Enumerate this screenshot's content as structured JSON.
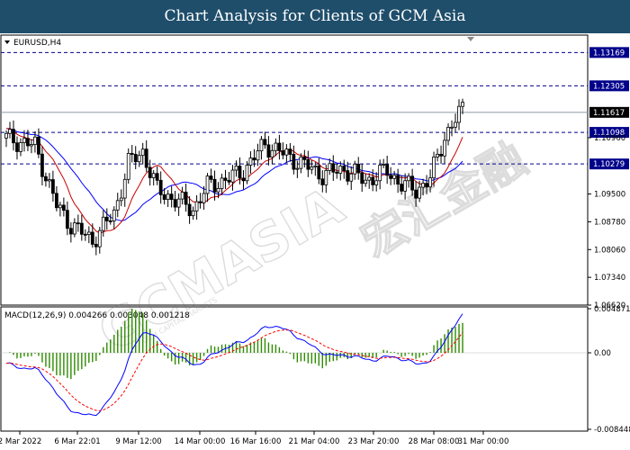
{
  "page": {
    "title": "Chart Analysis for Clients of GCM Asia"
  },
  "chart_data": {
    "type": "candlestick",
    "symbol_label": "EURUSD,H4",
    "price_axis_ticks": [
      "1.10960",
      "1.09500",
      "1.08780",
      "1.08060",
      "1.07340",
      "1.06620"
    ],
    "price_tick_values": [
      1.1096,
      1.095,
      1.0878,
      1.0806,
      1.0734,
      1.0662
    ],
    "horizontal_levels": [
      {
        "label": "1.13169",
        "value": 1.13169,
        "style": "dashed",
        "color": "#00008b"
      },
      {
        "label": "1.12305",
        "value": 1.12305,
        "style": "dashed",
        "color": "#00008b"
      },
      {
        "label": "1.11098",
        "value": 1.11098,
        "style": "dashed",
        "color": "#00008b"
      },
      {
        "label": "1.10279",
        "value": 1.10279,
        "style": "dashed",
        "color": "#00008b"
      }
    ],
    "current_price": {
      "label": "1.11617",
      "value": 1.11617,
      "color": "#000000"
    },
    "price_range": [
      1.0662,
      1.1362
    ],
    "moving_averages": [
      {
        "color": "#0000ff",
        "style": "solid"
      },
      {
        "color": "#cc0000",
        "style": "solid"
      }
    ],
    "candle_colors": {
      "bull": "#ffffff",
      "bear": "#000000",
      "outline": "#000000"
    },
    "time_axis_labels": [
      "2 Mar 2022",
      "6 Mar 22:01",
      "9 Mar 12:00",
      "14 Mar 00:00",
      "16 Mar 16:00",
      "21 Mar 04:00",
      "23 Mar 20:00",
      "28 Mar 08:00",
      "31 Mar 00:00"
    ],
    "macd": {
      "label": "MACD(12,26,9) 0.004266 0.003048 0.001218",
      "axis_ticks": [
        "0.004871",
        "0.00",
        "-0.008448"
      ],
      "axis_values": [
        0.004871,
        0.0,
        -0.008448
      ],
      "macd_line_color": "#0000ff",
      "signal_line_color": "#ff0000",
      "histogram_color": "#2e8b00"
    }
  },
  "watermark": {
    "brand": "GCMASIA",
    "chinese": "宏汇金融",
    "subtitle": "GCM CAPITAL MARKETS"
  },
  "colors": {
    "header_bg": "#1f4e6b",
    "level_tag_bg": "#00008b",
    "price_tag_bg": "#000000"
  }
}
